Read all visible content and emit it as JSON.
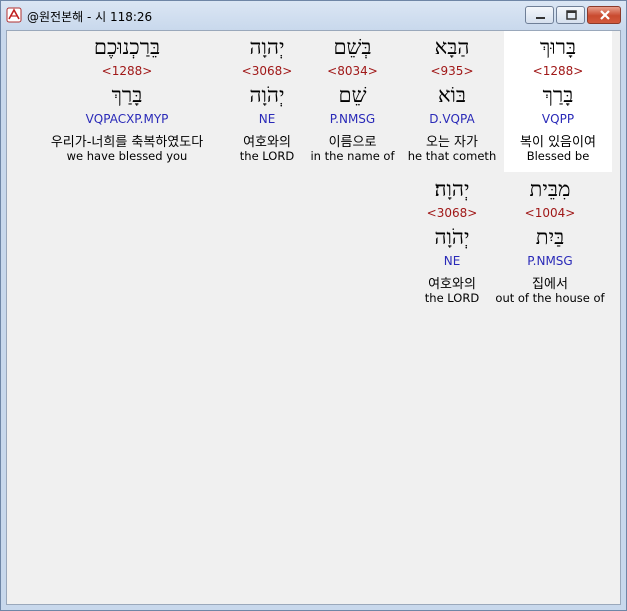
{
  "window": {
    "title": "@원전본해 - 시 118:26"
  },
  "words": [
    {
      "surface": "בָּרוּךְ",
      "strong": "<1288>",
      "lemma": "בָּרַךְ",
      "parse": "VQPP",
      "korean": "복이 있음이여",
      "english": "Blessed be"
    },
    {
      "surface": "הַבָּא",
      "strong": "<935>",
      "lemma": "בּוֹא",
      "parse": "D.VQPA",
      "korean": "오는 자가",
      "english": "he that cometh"
    },
    {
      "surface": "בְּשֵׁם",
      "strong": "<8034>",
      "lemma": "שֵׁם",
      "parse": "P.NMSG",
      "korean": "이름으로",
      "english": "in the name of"
    },
    {
      "surface": "יְהוָה",
      "strong": "<3068>",
      "lemma": "יְהֹוָה",
      "parse": "NE",
      "korean": "여호와의",
      "english": "the LORD"
    },
    {
      "surface": "בֵּרַכְנוּכֶם",
      "strong": "<1288>",
      "lemma": "בָּרַךְ",
      "parse": "VQPACXP.MYP",
      "korean": "우리가-너희를 축복하였도다",
      "english": "we have blessed you"
    },
    {
      "surface": "מִבֵּית",
      "strong": "<1004>",
      "lemma": "בַּיִת",
      "parse": "P.NMSG",
      "korean": "집에서",
      "english": "out of the house of"
    },
    {
      "surface": "יְהוָה׃",
      "strong": "<3068>",
      "lemma": "יְהֹוָה",
      "parse": "NE",
      "korean": "여호와의",
      "english": "the LORD"
    }
  ]
}
